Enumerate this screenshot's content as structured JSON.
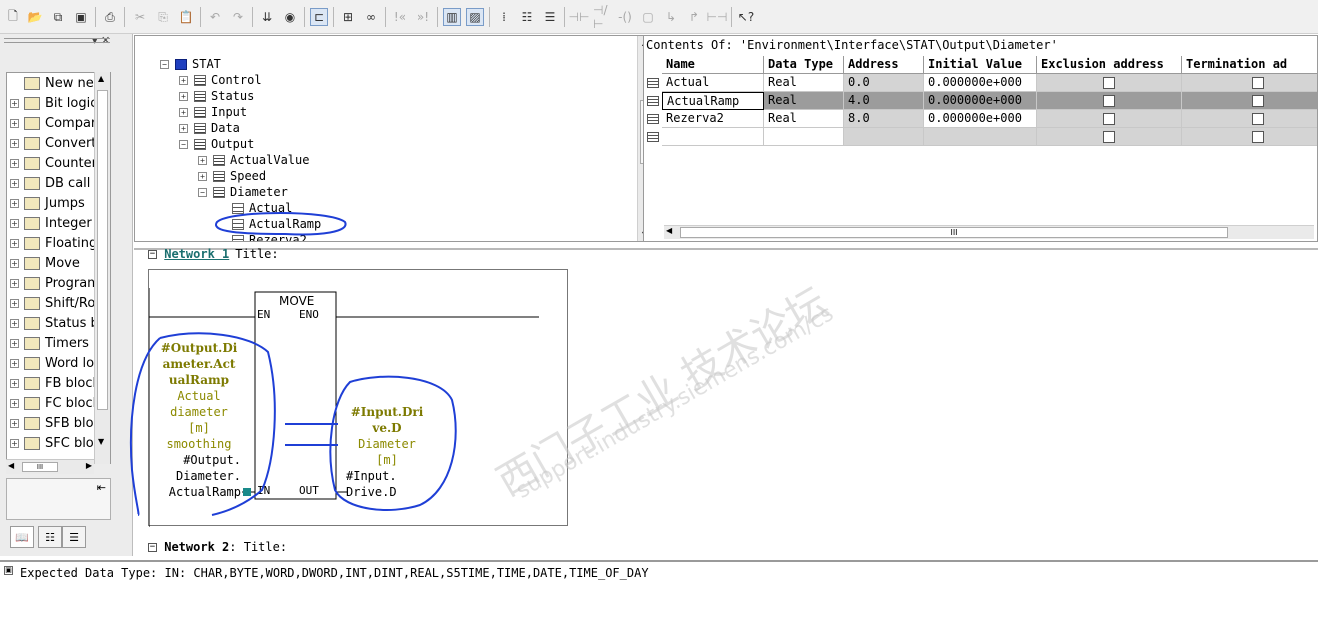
{
  "toolbar": {
    "icons": [
      "new-icon",
      "open-icon",
      "accessible-nodes-icon",
      "save-icon",
      "print-icon",
      "cut-icon",
      "copy-icon",
      "paste-icon",
      "undo-icon",
      "redo-icon",
      "download-icon",
      "monitor-icon",
      "insert-network-icon",
      "new-network-icon",
      "catalog-icon",
      "branch-open-icon",
      "branch-close-icon",
      "no-contact-icon",
      "nc-contact-icon",
      "coil-icon",
      "empty-box-icon",
      "branch-icon",
      "connection-icon",
      "help-pointer-icon"
    ]
  },
  "left_panel": {
    "items": [
      {
        "label": "New net",
        "icon": "new-network-icon"
      },
      {
        "label": "Bit logic",
        "icon": "bit-logic-icon"
      },
      {
        "label": "Compar",
        "icon": "comparator-icon"
      },
      {
        "label": "Converte",
        "icon": "converter-icon"
      },
      {
        "label": "Counter",
        "icon": "counter-icon"
      },
      {
        "label": "DB call",
        "icon": "db-call-icon"
      },
      {
        "label": "Jumps",
        "icon": "jumps-icon"
      },
      {
        "label": "Integer",
        "icon": "integer-icon"
      },
      {
        "label": "Floating",
        "icon": "floating-icon"
      },
      {
        "label": "Move",
        "icon": "move-icon"
      },
      {
        "label": "Program",
        "icon": "program-control-icon"
      },
      {
        "label": "Shift/Ro",
        "icon": "shift-rotate-icon"
      },
      {
        "label": "Status b",
        "icon": "status-bits-icon"
      },
      {
        "label": "Timers",
        "icon": "timers-icon"
      },
      {
        "label": "Word lo",
        "icon": "word-logic-icon"
      },
      {
        "label": "FB block",
        "icon": "fb-block-icon"
      },
      {
        "label": "FC block",
        "icon": "fc-block-icon"
      },
      {
        "label": "SFB bloc",
        "icon": "sfb-block-icon"
      },
      {
        "label": "SFC bloc",
        "icon": "sfc-block-icon"
      }
    ]
  },
  "tree": {
    "rows": [
      {
        "label": "STAT",
        "level": 0,
        "expander": "−",
        "kind": "stat"
      },
      {
        "label": "Control",
        "level": 1,
        "expander": "+",
        "kind": "struct"
      },
      {
        "label": "Status",
        "level": 1,
        "expander": "+",
        "kind": "struct"
      },
      {
        "label": "Input",
        "level": 1,
        "expander": "+",
        "kind": "struct"
      },
      {
        "label": "Data",
        "level": 1,
        "expander": "+",
        "kind": "struct"
      },
      {
        "label": "Output",
        "level": 1,
        "expander": "−",
        "kind": "struct"
      },
      {
        "label": "ActualValue",
        "level": 2,
        "expander": "+",
        "kind": "struct"
      },
      {
        "label": "Speed",
        "level": 2,
        "expander": "+",
        "kind": "struct"
      },
      {
        "label": "Diameter",
        "level": 2,
        "expander": "−",
        "kind": "struct"
      },
      {
        "label": "Actual",
        "level": 3,
        "expander": "",
        "kind": "leaf"
      },
      {
        "label": "ActualRamp",
        "level": 3,
        "expander": "",
        "kind": "leaf"
      },
      {
        "label": "Rezerva2",
        "level": 3,
        "expander": "",
        "kind": "leaf"
      }
    ]
  },
  "contents": {
    "title": "Contents Of: 'Environment\\Interface\\STAT\\Output\\Diameter'",
    "headers": [
      "Name",
      "Data Type",
      "Address",
      "Initial Value",
      "Exclusion address",
      "Termination ad"
    ],
    "rows": [
      {
        "name": "Actual",
        "type": "Real",
        "address": "0.0",
        "initial": "0.000000e+000",
        "exclusion": false,
        "termination": false
      },
      {
        "name": "ActualRamp",
        "type": "Real",
        "address": "4.0",
        "initial": "0.000000e+000",
        "exclusion": false,
        "termination": false
      },
      {
        "name": "Rezerva2",
        "type": "Real",
        "address": "8.0",
        "initial": "0.000000e+000",
        "exclusion": false,
        "termination": false
      },
      {
        "name": "",
        "type": "",
        "address": "",
        "initial": "",
        "exclusion": false,
        "termination": false
      }
    ],
    "selected_row": 1,
    "scroll_label": "III"
  },
  "network1": {
    "header_title": "Title:",
    "block": {
      "name": "MOVE",
      "en": "EN",
      "eno": "ENO",
      "in": "IN",
      "out": "OUT"
    },
    "in_symbol": [
      "#Output.Di",
      "ameter.Act",
      "ualRamp"
    ],
    "in_comment": [
      "Actual",
      "diameter",
      "[m]",
      "smoothing"
    ],
    "in_address": [
      "#Output.",
      "Diameter.",
      "ActualRamp"
    ],
    "out_symbol": [
      "#Input.Dri",
      "ve.D"
    ],
    "out_comment": [
      "Diameter",
      "[m]"
    ],
    "out_address": [
      "#Input.",
      "Drive.D"
    ]
  },
  "network2": {
    "label": "Network 2",
    "title": ": Title:"
  },
  "status_bar": {
    "text": "Expected Data Type: IN: CHAR,BYTE,WORD,DWORD,INT,DINT,REAL,S5TIME,TIME,DATE,TIME_OF_DAY"
  },
  "watermark": {
    "line1": "西门子工业 技术论坛",
    "line2": "support.industry.siemens.com/cs"
  },
  "colors": {
    "selection": "#9c9c9c",
    "olive": "#7d7a00",
    "annotation": "#1f3fd6"
  }
}
